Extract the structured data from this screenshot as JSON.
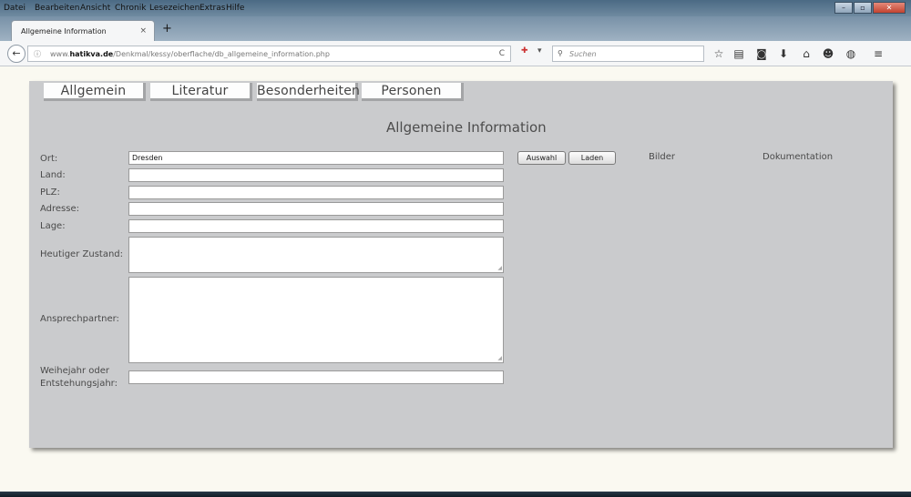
{
  "menubar": {
    "items": [
      "Datei",
      "Bearbeiten",
      "Ansicht",
      "Chronik",
      "Lesezeichen",
      "Extras",
      "Hilfe"
    ]
  },
  "tab": {
    "title": "Allgemeine Information",
    "close": "×",
    "new": "+"
  },
  "navbar": {
    "back": "←",
    "info": "ⓘ",
    "url_prefix": "www.",
    "url_domain": "hatikva.de",
    "url_path": "/Denkmal/kessy/oberflache/db_allgemeine_information.php",
    "reload": "C",
    "search_placeholder": "Suchen",
    "search_icon": "search-icon"
  },
  "page": {
    "tabs": [
      "Allgemein",
      "Literatur",
      "Besonderheiten",
      "Personen"
    ],
    "title": "Allgemeine Information",
    "labels": {
      "ort": "Ort:",
      "land": "Land:",
      "plz": "PLZ:",
      "adresse": "Adresse:",
      "lage": "Lage:",
      "zustand": "Heutiger Zustand:",
      "ansprechpartner": "Ansprechpartner:",
      "weihejahr_1": "Weihejahr oder",
      "weihejahr_2": "Entstehungsjahr:"
    },
    "values": {
      "ort": "Dresden",
      "land": "",
      "plz": "",
      "adresse": "",
      "lage": "",
      "zustand": "",
      "ansprechpartner": "",
      "weihejahr": ""
    },
    "buttons": {
      "auswahl": "Auswahl",
      "laden": "Laden"
    },
    "side_labels": {
      "bilder": "Bilder",
      "dokumentation": "Dokumentation"
    }
  },
  "colors": {
    "panel": "#cacbcd",
    "page_bg": "#faf9f1",
    "tab_shadow": "#a3a4a6"
  }
}
